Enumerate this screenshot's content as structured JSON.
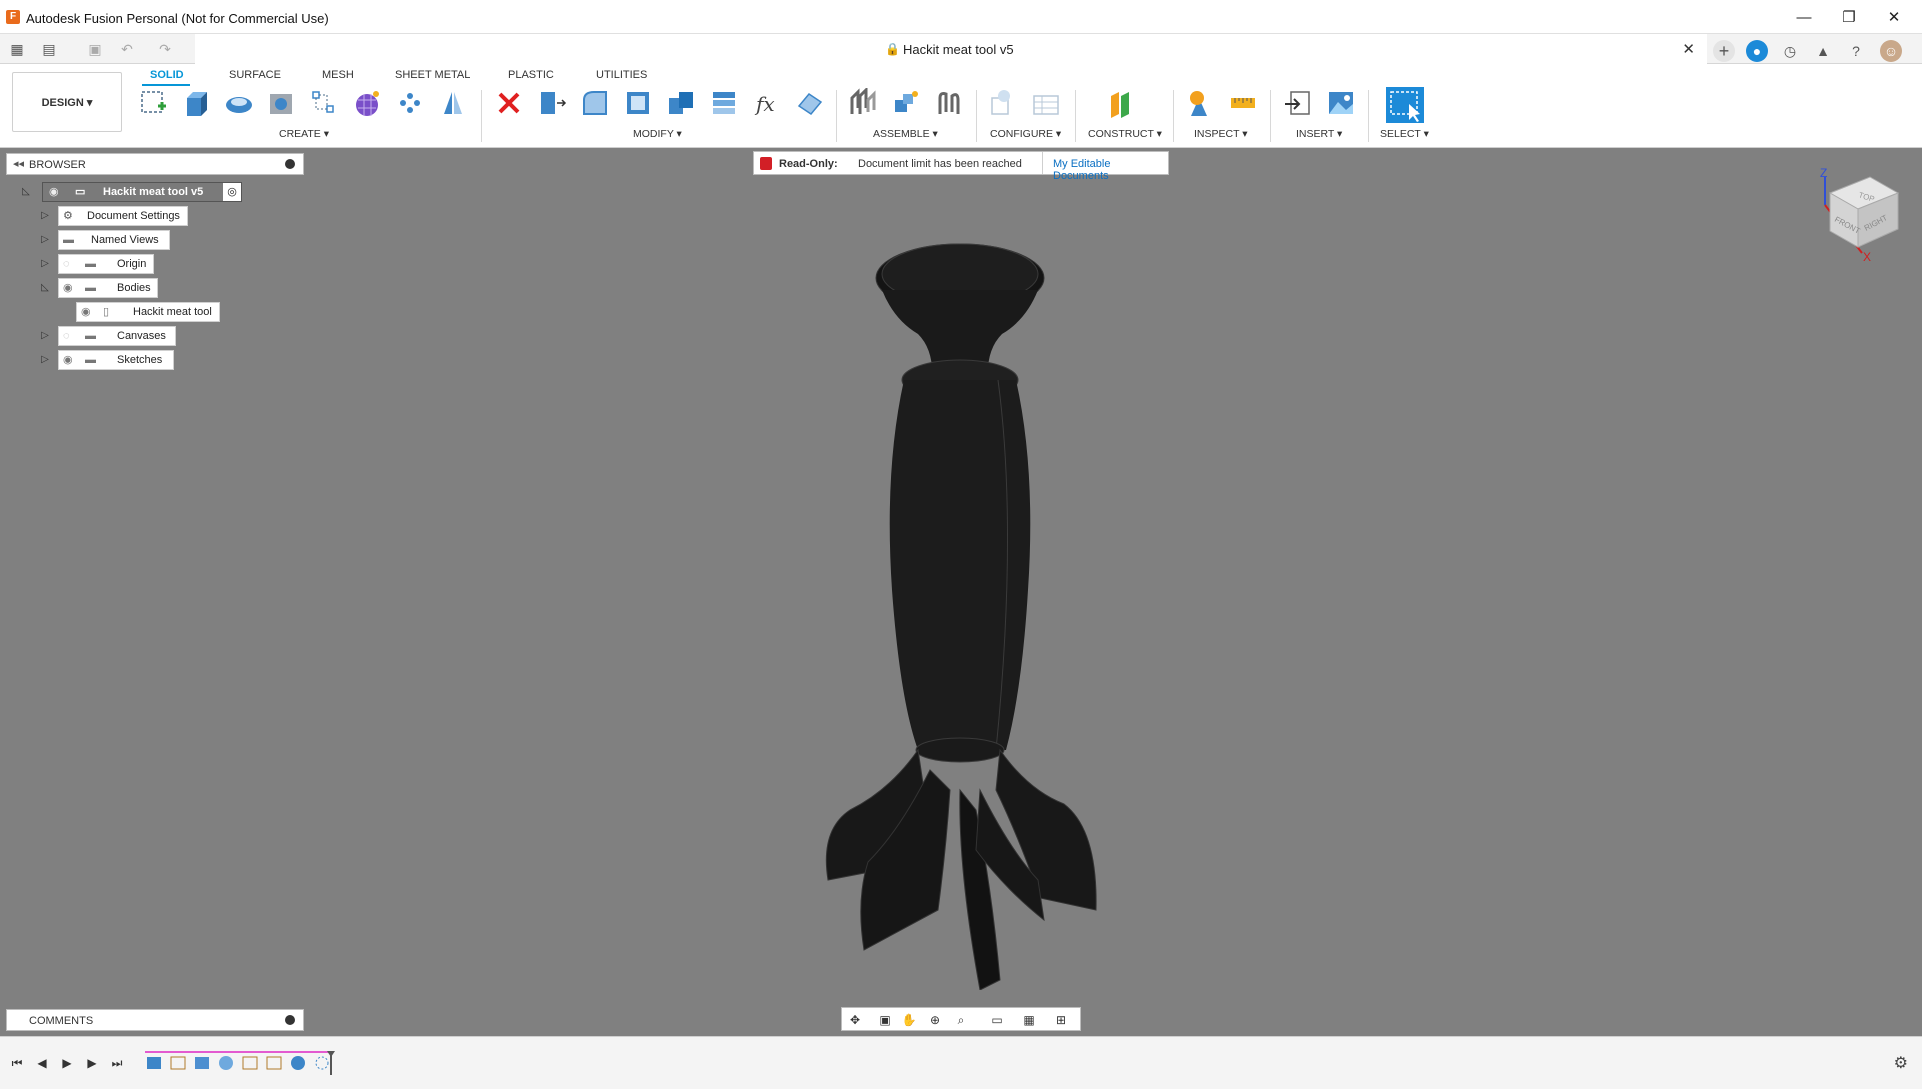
{
  "window": {
    "title": "Autodesk Fusion Personal (Not for Commercial Use)",
    "minimize": "—",
    "maximize": "❐",
    "close": "✕"
  },
  "document": {
    "tab_title": "Hackit meat tool v5",
    "tab_close": "✕"
  },
  "ribbon": {
    "workspace": "DESIGN ▾",
    "tabs": [
      "SOLID",
      "SURFACE",
      "MESH",
      "SHEET METAL",
      "PLASTIC",
      "UTILITIES"
    ],
    "active_tab": "SOLID",
    "groups": [
      "CREATE ▾",
      "MODIFY ▾",
      "ASSEMBLE ▾",
      "CONFIGURE ▾",
      "CONSTRUCT ▾",
      "INSPECT ▾",
      "INSERT ▾",
      "SELECT ▾"
    ]
  },
  "browser": {
    "title": "BROWSER",
    "root": "Hackit meat tool v5",
    "nodes": [
      "Document Settings",
      "Named Views",
      "Origin",
      "Bodies",
      "Hackit meat tool",
      "Canvases",
      "Sketches"
    ]
  },
  "banner": {
    "label": "Read-Only:",
    "message": "Document limit has been reached",
    "link": "My Editable Documents"
  },
  "viewcube": {
    "top": "TOP",
    "front": "FRONT",
    "right": "RIGHT",
    "z": "Z",
    "x": "X"
  },
  "comments": {
    "title": "COMMENTS"
  },
  "colors": {
    "accent": "#0696d7",
    "viewport": "#808080",
    "model": "#1c1c1c",
    "lock_red": "#d21f26"
  }
}
